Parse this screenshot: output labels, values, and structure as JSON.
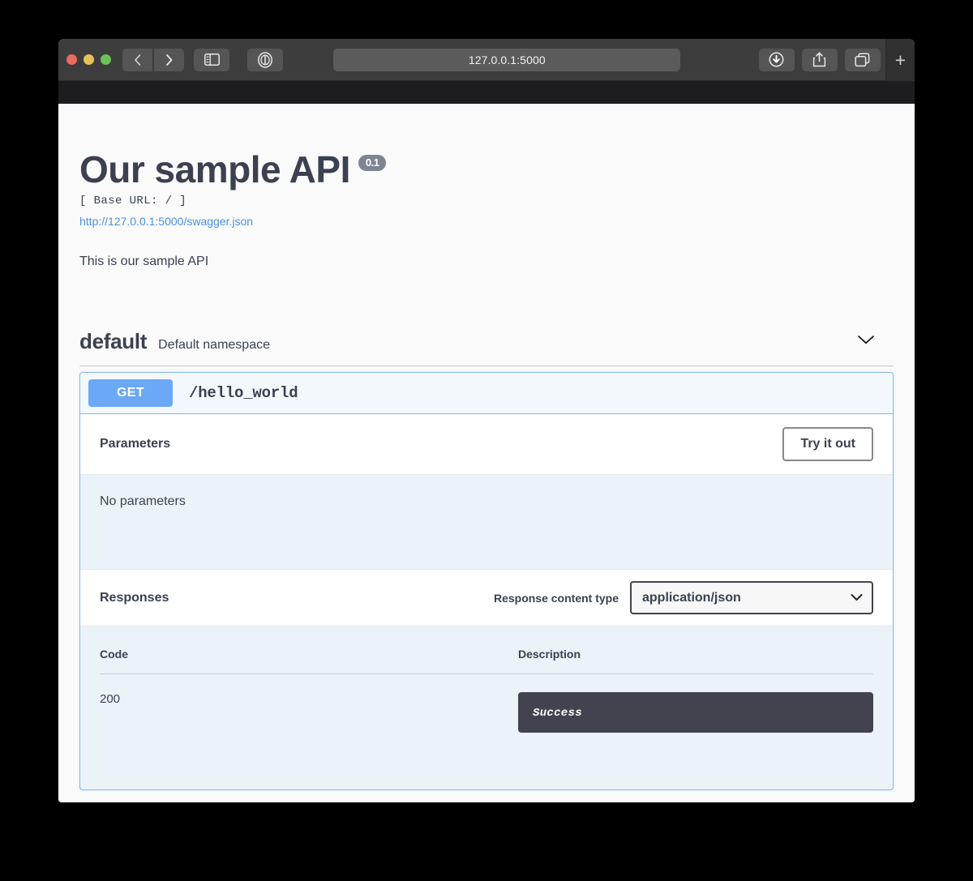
{
  "browser": {
    "url": "127.0.0.1:5000",
    "traffic_lights": [
      "close-button",
      "minimize-button",
      "maximize-button"
    ],
    "back_icon": "back-chevron-icon",
    "forward_icon": "forward-chevron-icon",
    "sidebar_icon": "sidebar-toggle-icon",
    "reader_icon": "reader-view-icon",
    "download_icon": "download-icon",
    "share_icon": "share-icon",
    "tabs_icon": "tab-overview-icon",
    "newtab_label": "+"
  },
  "api": {
    "title": "Our sample API",
    "version": "0.1",
    "base_url": "[ Base URL: / ]",
    "swagger_link": "http://127.0.0.1:5000/swagger.json",
    "description": "This is our sample API"
  },
  "namespace": {
    "name": "default",
    "description": "Default namespace",
    "collapse_icon": "chevron-down-icon"
  },
  "operation": {
    "method": "GET",
    "path": "/hello_world",
    "parameters_title": "Parameters",
    "try_it_out_label": "Try it out",
    "no_parameters_text": "No parameters",
    "responses_title": "Responses",
    "response_content_type_label": "Response content type",
    "content_type_selected": "application/json",
    "content_type_options": [
      "application/json"
    ],
    "table_headers": {
      "code": "Code",
      "description": "Description"
    },
    "rows": [
      {
        "code": "200",
        "description": "Success"
      }
    ]
  },
  "colors": {
    "method_get": "#6ba8f5",
    "opblock_border": "#87b9ea",
    "opblock_bg": "#ebf3f9",
    "text": "#3b4151",
    "badge": "#7d8492",
    "desc_box": "#41444e",
    "link": "#4a90e2"
  }
}
